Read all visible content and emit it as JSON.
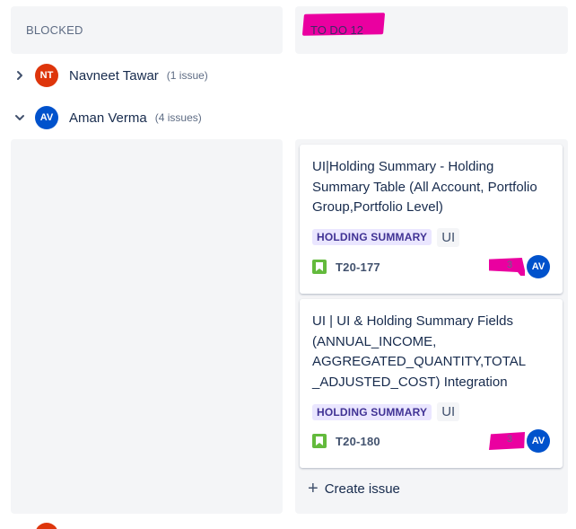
{
  "columns": {
    "blocked": {
      "title": "BLOCKED"
    },
    "todo": {
      "title": "TO DO 12"
    }
  },
  "swimlanes": [
    {
      "initials": "NT",
      "name": "Navneet Tawar",
      "count": "(1 issue)",
      "color": "#de350b",
      "expanded": false
    },
    {
      "initials": "AV",
      "name": "Aman Verma",
      "count": "(4 issues)",
      "color": "#0052cc",
      "expanded": true
    }
  ],
  "cards": [
    {
      "title": "UI|Holding Summary - Holding Summary Table (All Account, Portfolio Group,Portfolio Level)",
      "epic": "HOLDING SUMMARY",
      "label": "UI",
      "key": "T20-177",
      "estimate": "3",
      "assignee": "AV"
    },
    {
      "title": "UI | UI & Holding Summary Fields (ANNUAL_INCOME, AGGREGATED_QUANTITY,TOTAL _ADJUSTED_COST) Integration",
      "epic": "HOLDING SUMMARY",
      "label": "UI",
      "key": "T20-180",
      "estimate": "3",
      "assignee": "AV"
    }
  ],
  "create_issue_label": "Create issue",
  "colors": {
    "highlight": "#ea00a0",
    "epic_bg": "#eae6ff",
    "epic_text": "#403294",
    "story": "#63ba3c",
    "assignee": "#0052cc"
  }
}
